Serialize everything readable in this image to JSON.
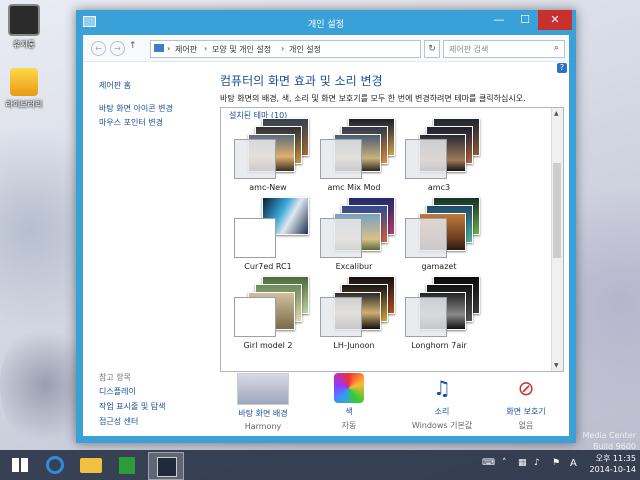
{
  "desktop": {
    "icons": [
      {
        "label": "휴지통"
      },
      {
        "label": "라이브러리"
      }
    ],
    "watermark_line1": "Media Center",
    "watermark_line2": "Build 9600"
  },
  "window": {
    "title": "개인 설정",
    "buttons": {
      "minimize": "—",
      "maximize": "☐",
      "close": "✕"
    },
    "address": {
      "back": "←",
      "forward": "→",
      "up": "↑",
      "crumbs": [
        "제어판",
        "모양 및 개인 설정",
        "개인 설정"
      ],
      "separator": "›",
      "dropdown": "▾",
      "refresh": "↻"
    },
    "search": {
      "placeholder": "제어판 검색",
      "icon": "⌕"
    },
    "help": "?"
  },
  "sidebar": {
    "home": "제어판 홈",
    "links": [
      "바탕 화면 아이콘 변경",
      "마우스 포인터 변경"
    ],
    "see_also_header": "참고 항목",
    "see_also": [
      "디스플레이",
      "작업 표시줄 및 탐색",
      "접근성 센터"
    ]
  },
  "main": {
    "title": "컴퓨터의 화면 효과 및 소리 변경",
    "description": "바탕 화면의 배경, 색, 소리 및 화면 보호기를 모두 한 번에 변경하려면 테마를 클릭하십시오.",
    "group_label": "설치된 테마 (10)",
    "scroll_up": "▲",
    "scroll_down": "▼",
    "themes": [
      {
        "name": "amc-New"
      },
      {
        "name": "amc Mix Mod"
      },
      {
        "name": "amc3"
      },
      {
        "name": "Cur7ed RC1"
      },
      {
        "name": "Excalibur"
      },
      {
        "name": "gamazet"
      },
      {
        "name": "Girl model 2"
      },
      {
        "name": "LH-Junoon"
      },
      {
        "name": "Longhorn 7air"
      }
    ]
  },
  "bottom": [
    {
      "label": "바탕 화면 배경",
      "sub": "Harmony"
    },
    {
      "label": "색",
      "sub": "자동"
    },
    {
      "label": "소리",
      "sub": "Windows 기본값"
    },
    {
      "label": "화면 보호기",
      "sub": "없음"
    }
  ],
  "taskbar": {
    "tray": {
      "lang": "A",
      "time": "오후 11:35",
      "date": "2014-10-14"
    }
  },
  "colors": {
    "titlebar": "#3aa1d8",
    "close": "#c7302c",
    "link": "#1b4f9c",
    "heading": "#1e4d9b"
  }
}
